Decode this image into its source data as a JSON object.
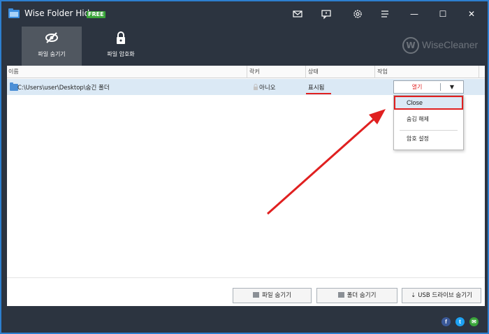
{
  "window": {
    "title": "Wise Folder Hider",
    "badge": "FREE",
    "controls": {
      "mail_icon": "mail-icon",
      "feedback_icon": "chat-icon",
      "settings_icon": "gear-icon",
      "menu_icon": "menu-icon",
      "minimize_glyph": "—",
      "maximize_glyph": "☐",
      "close_glyph": "✕"
    }
  },
  "toolbar": {
    "tabs": [
      {
        "label": "파일 숨기기",
        "icon": "eye-slash-icon",
        "active": true
      },
      {
        "label": "파일 암호화",
        "icon": "lock-icon",
        "active": false
      }
    ],
    "brand": "WiseCleaner",
    "brand_logo": "W"
  },
  "table": {
    "headers": [
      "이름",
      "락커",
      "상태",
      "작업"
    ],
    "rows": [
      {
        "name": "C:\\Users\\user\\Desktop\\숨긴 폴더",
        "locker": "아니오",
        "status": "표시됨",
        "action": "열기",
        "action_arrow": "▼"
      }
    ]
  },
  "dropdown_menu": {
    "items": [
      "Close",
      "숨김 해제",
      "암호 설정"
    ],
    "highlighted": "Close"
  },
  "actions": {
    "hide_file": "파일 숨기기",
    "hide_folder": "폴더 숨기기",
    "hide_usb": "USB 드라이브 숨기기"
  },
  "social": [
    "f",
    "t",
    "✉"
  ],
  "colors": {
    "chrome": "#2c3440",
    "accent_red": "#e02020",
    "row_selected": "#dbe9f5",
    "facebook": "#3b5998",
    "twitter": "#1da1f2",
    "email": "#3aa53a"
  }
}
